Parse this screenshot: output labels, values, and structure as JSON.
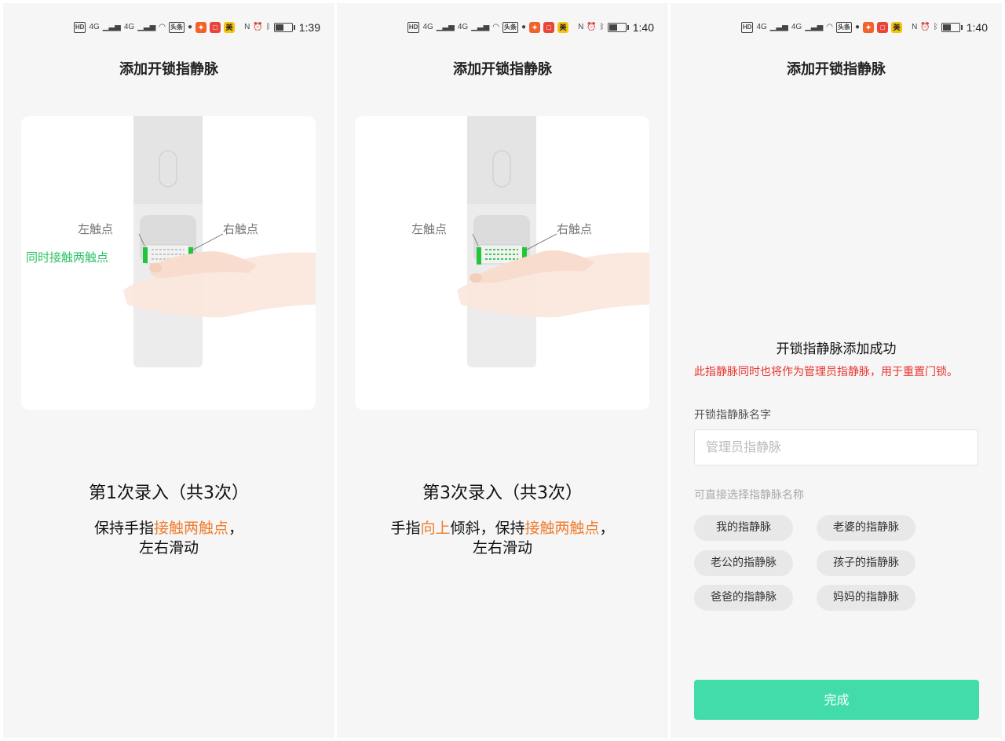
{
  "status_bars": [
    {
      "time": "1:39"
    },
    {
      "time": "1:40"
    },
    {
      "time": "1:40"
    }
  ],
  "status_icons": {
    "hd": "HD",
    "net": "4G",
    "toutiao": "头条",
    "meituan": "美"
  },
  "page_title": "添加开锁指静脉",
  "screen1": {
    "left_point": "左触点",
    "right_point": "右触点",
    "touch_both": "同时接触两触点",
    "step": "第1次录入（共3次）",
    "hint_a": "保持手指",
    "hint_highlight": "接触两触点",
    "hint_b": "，",
    "hint_line2": "左右滑动"
  },
  "screen2": {
    "left_point": "左触点",
    "right_point": "右触点",
    "step": "第3次录入（共3次）",
    "hint_a": "手指",
    "hint_highlight1": "向上",
    "hint_b": "倾斜，保持",
    "hint_highlight2": "接触两触点",
    "hint_c": "，",
    "hint_line2": "左右滑动"
  },
  "screen3": {
    "success_title": "开锁指静脉添加成功",
    "warning": "此指静脉同时也将作为管理员指静脉，用于重置门锁。",
    "name_label": "开锁指静脉名字",
    "name_value": "管理员指静脉",
    "suggest_label": "可直接选择指静脉名称",
    "chips": [
      "我的指静脉",
      "老婆的指静脉",
      "老公的指静脉",
      "孩子的指静脉",
      "爸爸的指静脉",
      "妈妈的指静脉"
    ],
    "done_button": "完成"
  },
  "colors": {
    "accent_green": "#42dcaa",
    "highlight_orange": "#f07c2e",
    "warning_red": "#e8352f",
    "touch_green": "#2fc266"
  }
}
